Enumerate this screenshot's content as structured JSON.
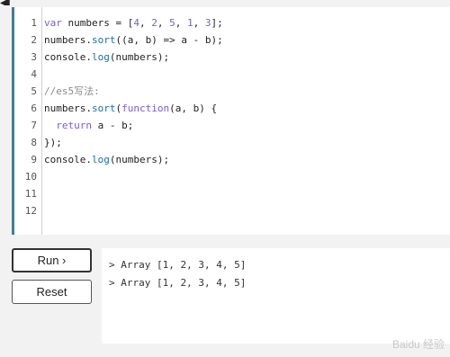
{
  "editor": {
    "line_numbers": [
      "1",
      "2",
      "3",
      "4",
      "5",
      "6",
      "7",
      "8",
      "9",
      "10",
      "11",
      "12"
    ],
    "lines": [
      {
        "tokens": [
          {
            "t": "var",
            "c": "kw"
          },
          {
            "t": " numbers = [",
            "c": ""
          },
          {
            "t": "4",
            "c": "num"
          },
          {
            "t": ", ",
            "c": ""
          },
          {
            "t": "2",
            "c": "num"
          },
          {
            "t": ", ",
            "c": ""
          },
          {
            "t": "5",
            "c": "num"
          },
          {
            "t": ", ",
            "c": ""
          },
          {
            "t": "1",
            "c": "num"
          },
          {
            "t": ", ",
            "c": ""
          },
          {
            "t": "3",
            "c": "num"
          },
          {
            "t": "];",
            "c": ""
          }
        ]
      },
      {
        "tokens": [
          {
            "t": "numbers.",
            "c": ""
          },
          {
            "t": "sort",
            "c": "fn"
          },
          {
            "t": "((a, b) => a - b);",
            "c": ""
          }
        ]
      },
      {
        "tokens": [
          {
            "t": "console.",
            "c": ""
          },
          {
            "t": "log",
            "c": "fn"
          },
          {
            "t": "(numbers);",
            "c": ""
          }
        ]
      },
      {
        "tokens": []
      },
      {
        "tokens": [
          {
            "t": "//es5写法:",
            "c": "cmt"
          }
        ]
      },
      {
        "tokens": [
          {
            "t": "numbers.",
            "c": ""
          },
          {
            "t": "sort",
            "c": "fn"
          },
          {
            "t": "(",
            "c": ""
          },
          {
            "t": "function",
            "c": "kw"
          },
          {
            "t": "(a, b) {",
            "c": ""
          }
        ]
      },
      {
        "tokens": [
          {
            "t": "  ",
            "c": ""
          },
          {
            "t": "return",
            "c": "kw"
          },
          {
            "t": " a - b;",
            "c": ""
          }
        ]
      },
      {
        "tokens": [
          {
            "t": "});",
            "c": ""
          }
        ]
      },
      {
        "tokens": [
          {
            "t": "console.",
            "c": ""
          },
          {
            "t": "log",
            "c": "fn"
          },
          {
            "t": "(numbers);",
            "c": ""
          }
        ]
      },
      {
        "tokens": []
      },
      {
        "tokens": []
      },
      {
        "tokens": []
      }
    ]
  },
  "buttons": {
    "run_label": "Run ›",
    "reset_label": "Reset"
  },
  "output": {
    "lines": [
      "> Array [1, 2, 3, 4, 5]",
      "> Array [1, 2, 3, 4, 5]"
    ]
  },
  "watermark": {
    "text": "Baidu 经验",
    "is_logo": true
  },
  "colors": {
    "editor_accent": "#3d7f9a",
    "keyword": "#7b5bd6",
    "function": "#1b6fa6",
    "comment": "#8a8a8a"
  }
}
